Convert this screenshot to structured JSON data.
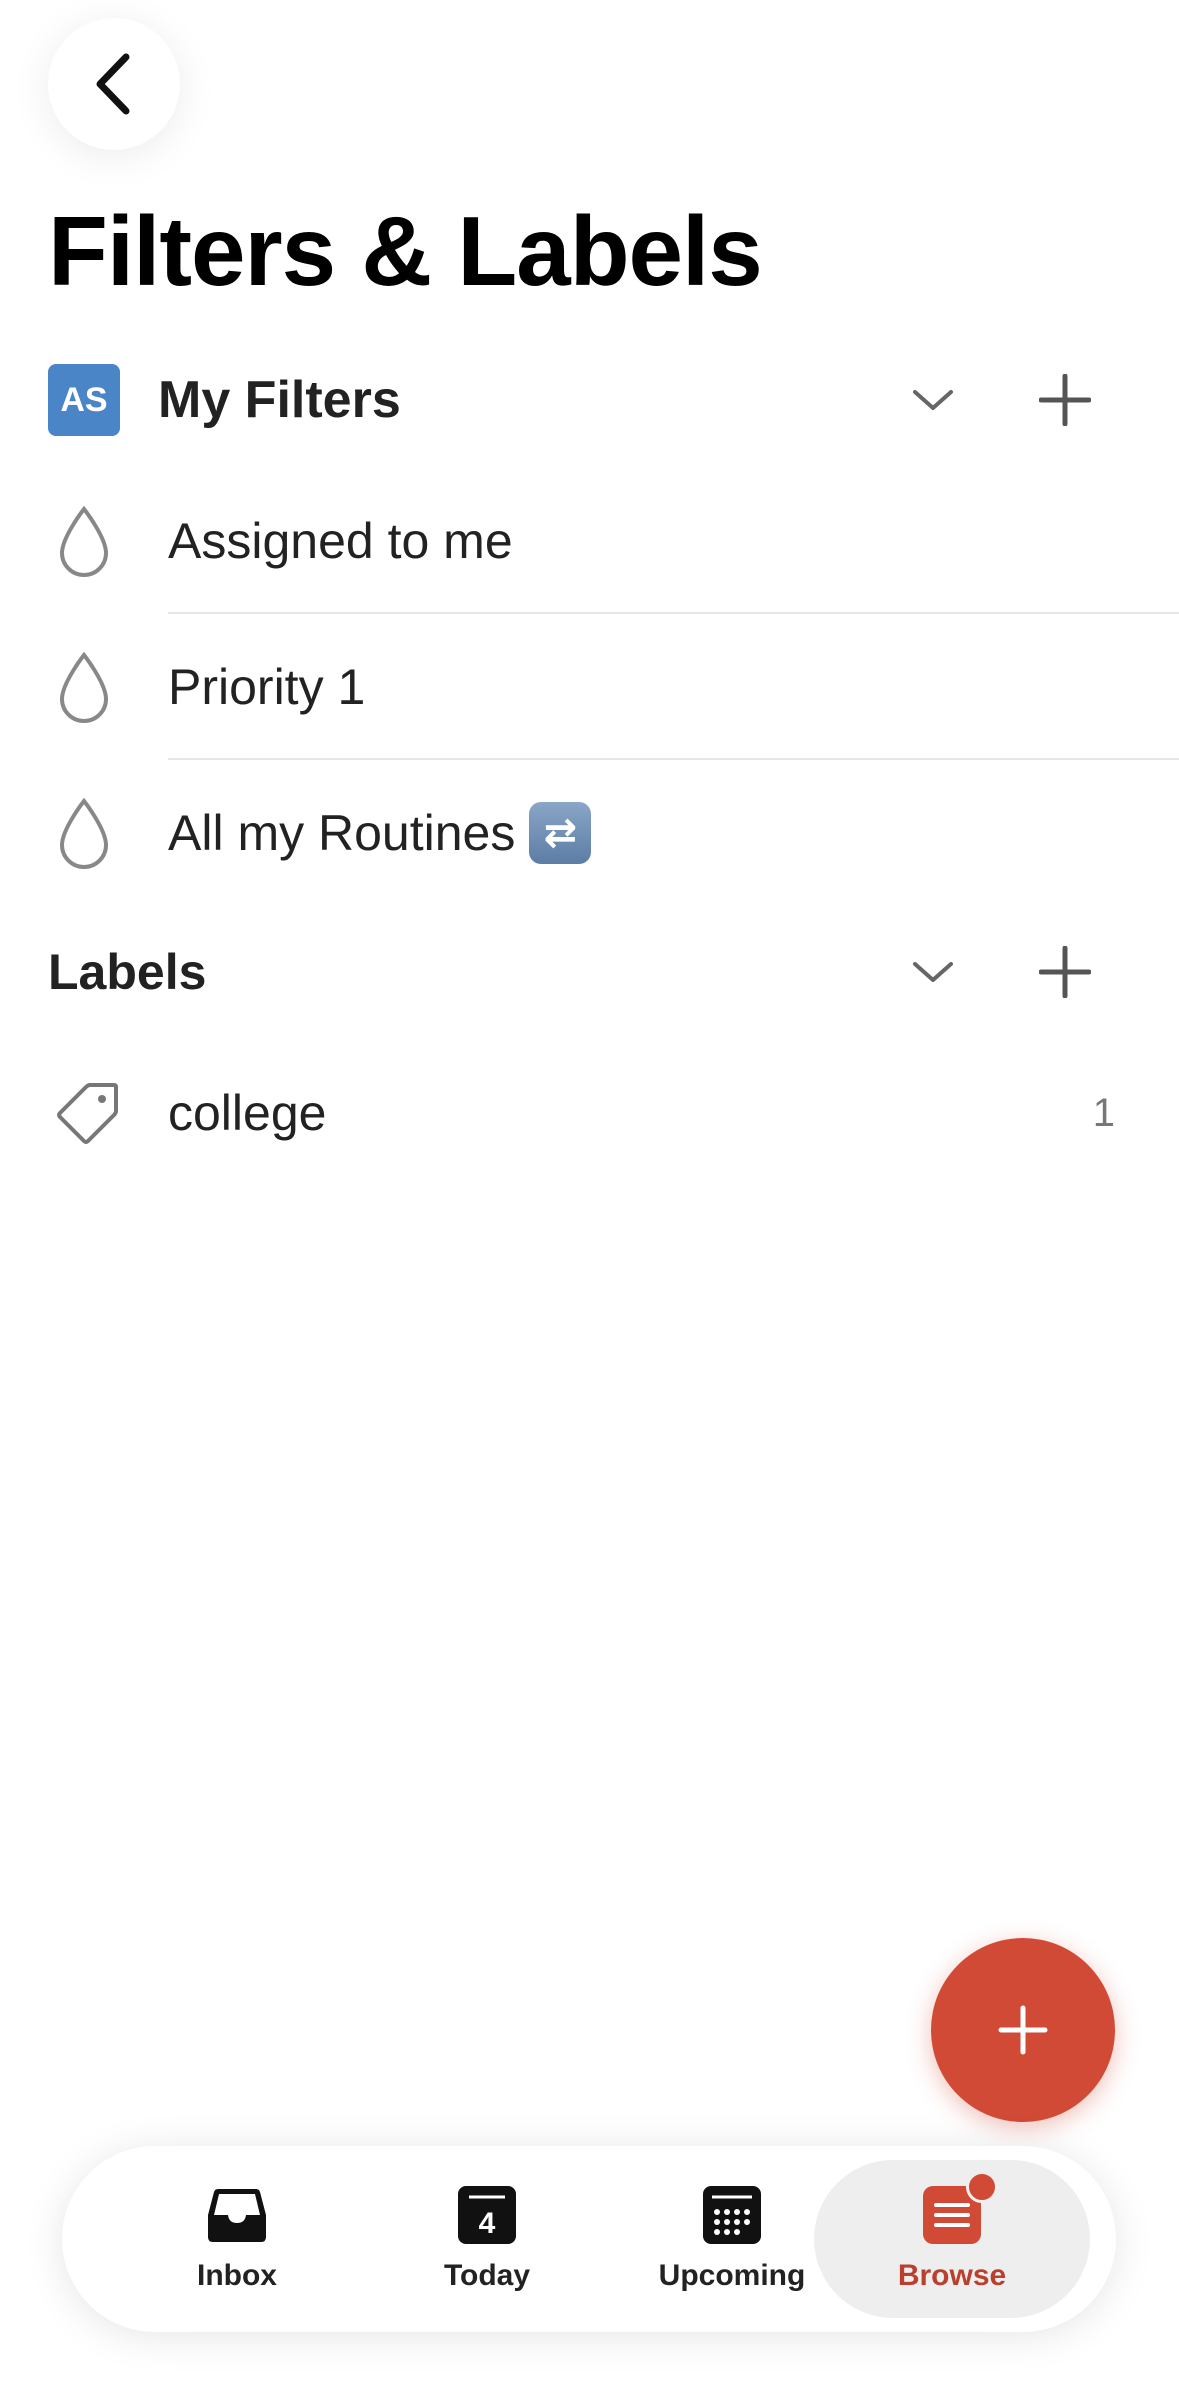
{
  "header": {
    "back_icon": "chevron-left-icon",
    "title": "Filters & Labels"
  },
  "filters_section": {
    "avatar_initials": "AS",
    "avatar_color": "#4a86c7",
    "title": "My Filters",
    "collapse_icon": "chevron-down-icon",
    "add_icon": "plus-icon",
    "items": [
      {
        "label": "Assigned to me",
        "icon": "drop-icon"
      },
      {
        "label": "Priority 1",
        "icon": "drop-icon"
      },
      {
        "label": "All my Routines",
        "icon": "drop-icon",
        "emoji": "🔁"
      }
    ]
  },
  "labels_section": {
    "title": "Labels",
    "collapse_icon": "chevron-down-icon",
    "add_icon": "plus-icon",
    "items": [
      {
        "label": "college",
        "icon": "tag-icon",
        "count": "1"
      }
    ]
  },
  "fab": {
    "icon": "plus-icon",
    "color": "#d14a35"
  },
  "tabbar": {
    "tabs": [
      {
        "label": "Inbox",
        "icon": "inbox-icon"
      },
      {
        "label": "Today",
        "icon": "calendar-today-icon",
        "icon_text": "4"
      },
      {
        "label": "Upcoming",
        "icon": "calendar-grid-icon"
      },
      {
        "label": "Browse",
        "icon": "browse-icon",
        "active": true,
        "badge": true
      }
    ],
    "accent_color": "#b9402d"
  }
}
